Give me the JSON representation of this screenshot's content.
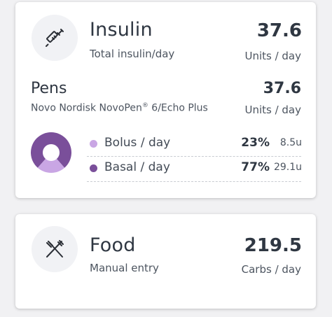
{
  "insulin": {
    "title": "Insulin",
    "subtitle": "Total insulin/day",
    "value": "37.6",
    "unit": "Units / day",
    "icon": "syringe-icon"
  },
  "pens": {
    "title": "Pens",
    "device_name": "Novo Nordisk NovoPen",
    "device_suffix": " 6/Echo Plus",
    "registered_mark": "®",
    "value": "37.6",
    "unit": "Units / day"
  },
  "breakdown": {
    "bolus": {
      "label": "Bolus / day",
      "percent": "23%",
      "amount": "8.5u",
      "fraction": 0.23,
      "color": "#c9a6e4"
    },
    "basal": {
      "label": "Basal / day",
      "percent": "77%",
      "amount": "29.1u",
      "fraction": 0.77,
      "color": "#7a4f9a"
    }
  },
  "food": {
    "title": "Food",
    "subtitle": "Manual entry",
    "value": "219.5",
    "unit": "Carbs / day",
    "icon": "utensils-icon"
  }
}
